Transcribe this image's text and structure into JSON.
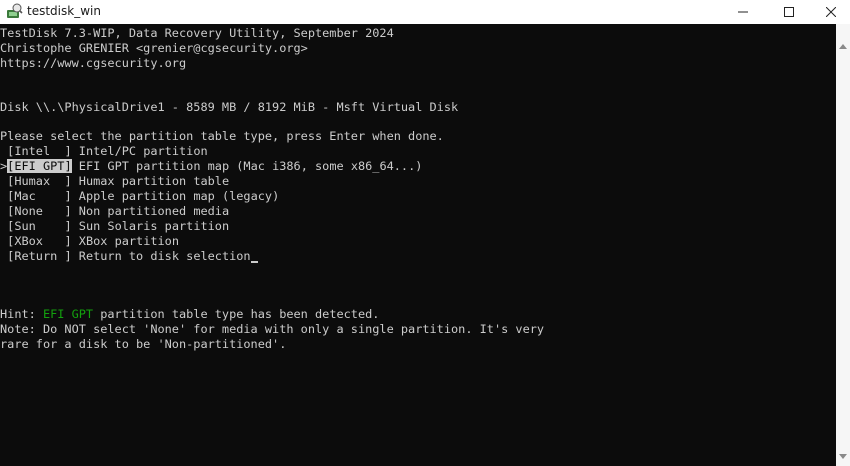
{
  "window": {
    "title": "testdisk_win",
    "icons": {
      "app": "testdisk-app-icon",
      "minimize": "minimize-icon",
      "maximize": "maximize-icon",
      "close": "close-icon"
    }
  },
  "console": {
    "header": [
      "TestDisk 7.3-WIP, Data Recovery Utility, September 2024",
      "Christophe GRENIER <grenier@cgsecurity.org>",
      "https://www.cgsecurity.org"
    ],
    "disk": "Disk \\\\.\\PhysicalDrive1 - 8589 MB / 8192 MiB - Msft Virtual Disk",
    "prompt": "Please select the partition table type, press Enter when done.",
    "menu_selected_marker": ">",
    "menu": [
      {
        "key": "[Intel  ]",
        "desc": "Intel/PC partition"
      },
      {
        "key": "[EFI GPT]",
        "desc": "EFI GPT partition map (Mac i386, some x86_64...)"
      },
      {
        "key": "[Humax  ]",
        "desc": "Humax partition table"
      },
      {
        "key": "[Mac    ]",
        "desc": "Apple partition map (legacy)"
      },
      {
        "key": "[None   ]",
        "desc": "Non partitioned media"
      },
      {
        "key": "[Sun    ]",
        "desc": "Sun Solaris partition"
      },
      {
        "key": "[XBox   ]",
        "desc": "XBox partition"
      },
      {
        "key": "[Return ]",
        "desc": "Return to disk selection"
      }
    ],
    "selected_index": 1,
    "hint_prefix": "Hint: ",
    "hint_highlight": "EFI GPT",
    "hint_suffix": " partition table type has been detected.",
    "note_line1": "Note: Do NOT select 'None' for media with only a single partition. It's very",
    "note_line2": "rare for a disk to be 'Non-partitioned'."
  },
  "colors": {
    "console_bg": "#0c0c0c",
    "console_fg": "#cccccc",
    "hint_green": "#13a10e"
  }
}
